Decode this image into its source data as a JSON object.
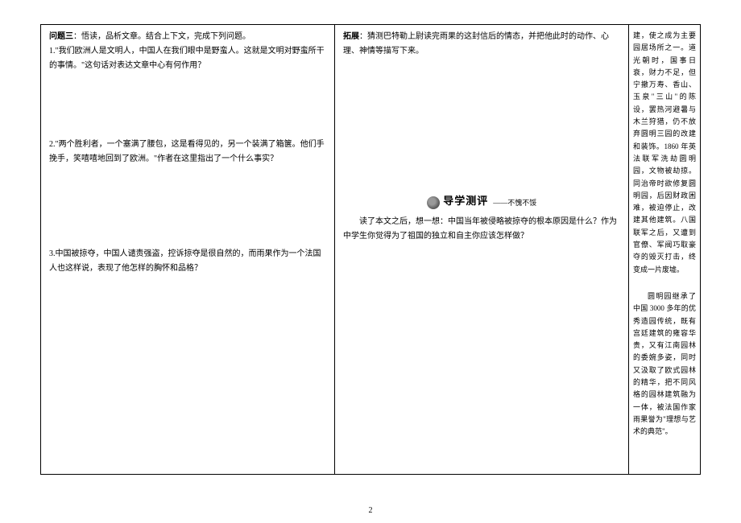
{
  "left_column": {
    "q3_title": "问题三",
    "q3_intro": "：悟读，品析文章。结合上下文，完成下列问题。",
    "q1_text": "1.\"我们欧洲人是文明人，中国人在我们眼中是野蛮人。这就是文明对野蛮所干的事情。\"这句话对表达文章中心有何作用？",
    "q2_text": "2.\"两个胜利者，一个塞满了腰包，这是看得见的，另一个装满了箱箧。他们手挽手，笑嘻嘻地回到了欧洲。\"作者在这里指出了一个什么事实？",
    "q3_text": "3.中国被掠夺，中国人谴责强盗，控诉掠夺是很自然的，而雨果作为一个法国人也这样说，表现了他怎样的胸怀和品格？"
  },
  "middle_column": {
    "tuozhan_title": "拓展",
    "tuozhan_text": "：猜测巴特勒上尉读完雨果的这封信后的情态，并把他此时的动作、心理、神情等描写下来。",
    "eval_title": "导学测评",
    "eval_sub": "——不愧不馁",
    "eval_text": "读了本文之后，想一想：中国当年被侵略被掠夺的根本原因是什么？作为中学生你觉得为了祖国的独立和自主你应该怎样做？"
  },
  "right_column": {
    "para1": "建，使之成为主要园居场所之一。道光朝时，国事日衰，财力不足，但宁撤万寿、香山、玉泉\"三山\"的陈设，罢热河避暑与木兰狩猎，仍不放弃圆明三园的改建和装饰。1860 年英法联军洗劫圆明园，文物被劫掠。同治帝时欲修复圆明园，后因财政困难，被迫停止，改建其他建筑。八国联军之后，又遭到官僚、军阀巧取豪夺的毁灭打击，终变成一片废墟。",
    "para2": "圆明园继承了中国 3000 多年的优秀造园传统，既有宫廷建筑的雍容华贵，又有江南园林的委婉多姿，同时又汲取了欧式园林的精华，把不同风格的园林建筑融为一体，被法国作家雨果誉为\"理想与艺术的典范\"。"
  },
  "page_number": "2"
}
